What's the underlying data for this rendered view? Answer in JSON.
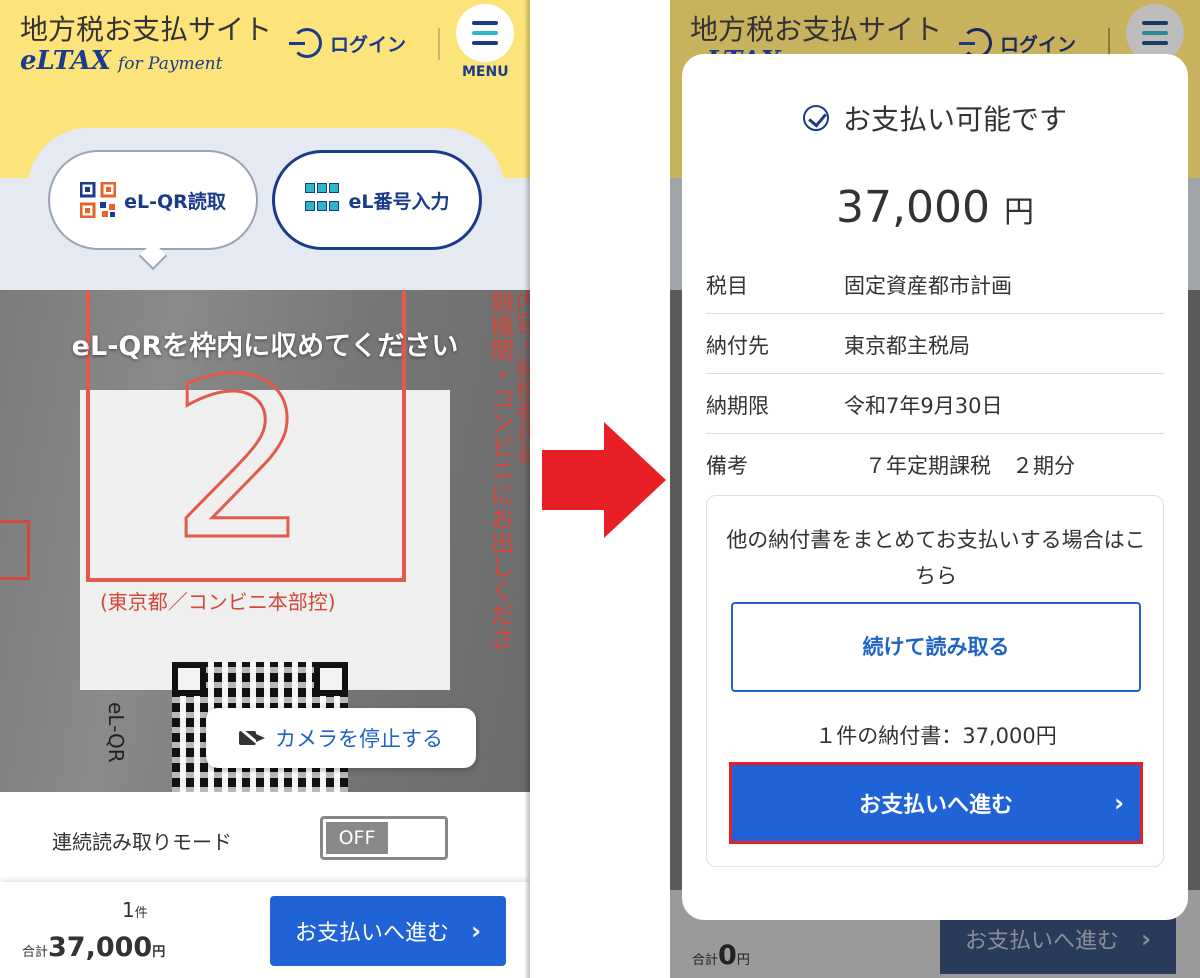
{
  "header": {
    "site_title": "地方税お支払サイト",
    "logo_main": "eLTAX",
    "logo_sub": "for Payment",
    "login_label": "ログイン",
    "menu_label": "MENU"
  },
  "tabs": {
    "qr_label": "eL-QR読取",
    "number_label": "eL番号入力"
  },
  "camera": {
    "instruction": "eL-QRを枠内に収めてください",
    "stop_label": "カメラを停止する",
    "paper_red_text": "(東京都／コンビニ本部控)",
    "paper_side_text": "融機関・コンビニにお出しくださ",
    "paper_side_text2": "内容・納税者氏名",
    "paper_qr_text": "eL-QR",
    "paper_digit": "2"
  },
  "mode": {
    "label": "連続読み取りモード",
    "toggle_state": "OFF"
  },
  "footer_left": {
    "count": "1",
    "count_unit": "件",
    "total_prefix": "合計",
    "total": "37,000",
    "total_unit": "円",
    "pay_label": "お支払いへ進む"
  },
  "modal": {
    "status": "お支払い可能です",
    "amount": "37,000",
    "amount_unit": "円",
    "rows": [
      {
        "key": "税目",
        "value": "固定資産都市計画"
      },
      {
        "key": "納付先",
        "value": "東京都主税局"
      },
      {
        "key": "納期限",
        "value": "令和7年9月30日"
      },
      {
        "key": "備考",
        "value": "　７年定期課税　２期分"
      }
    ],
    "multi_text": "他の納付書をまとめてお支払いする場合はこちら",
    "continue_label": "続けて読み取る",
    "count_line": "１件の納付書：37,000円",
    "pay_label": "お支払いへ進む"
  },
  "footer_right": {
    "total_prefix": "合計",
    "total": "0",
    "total_unit": "円",
    "pay_label": "お支払いへ進む"
  },
  "colors": {
    "header_yellow": "#fde47a",
    "brand_navy": "#1a3a8a",
    "action_blue": "#1f63d6",
    "highlight_red": "#e81f26"
  }
}
